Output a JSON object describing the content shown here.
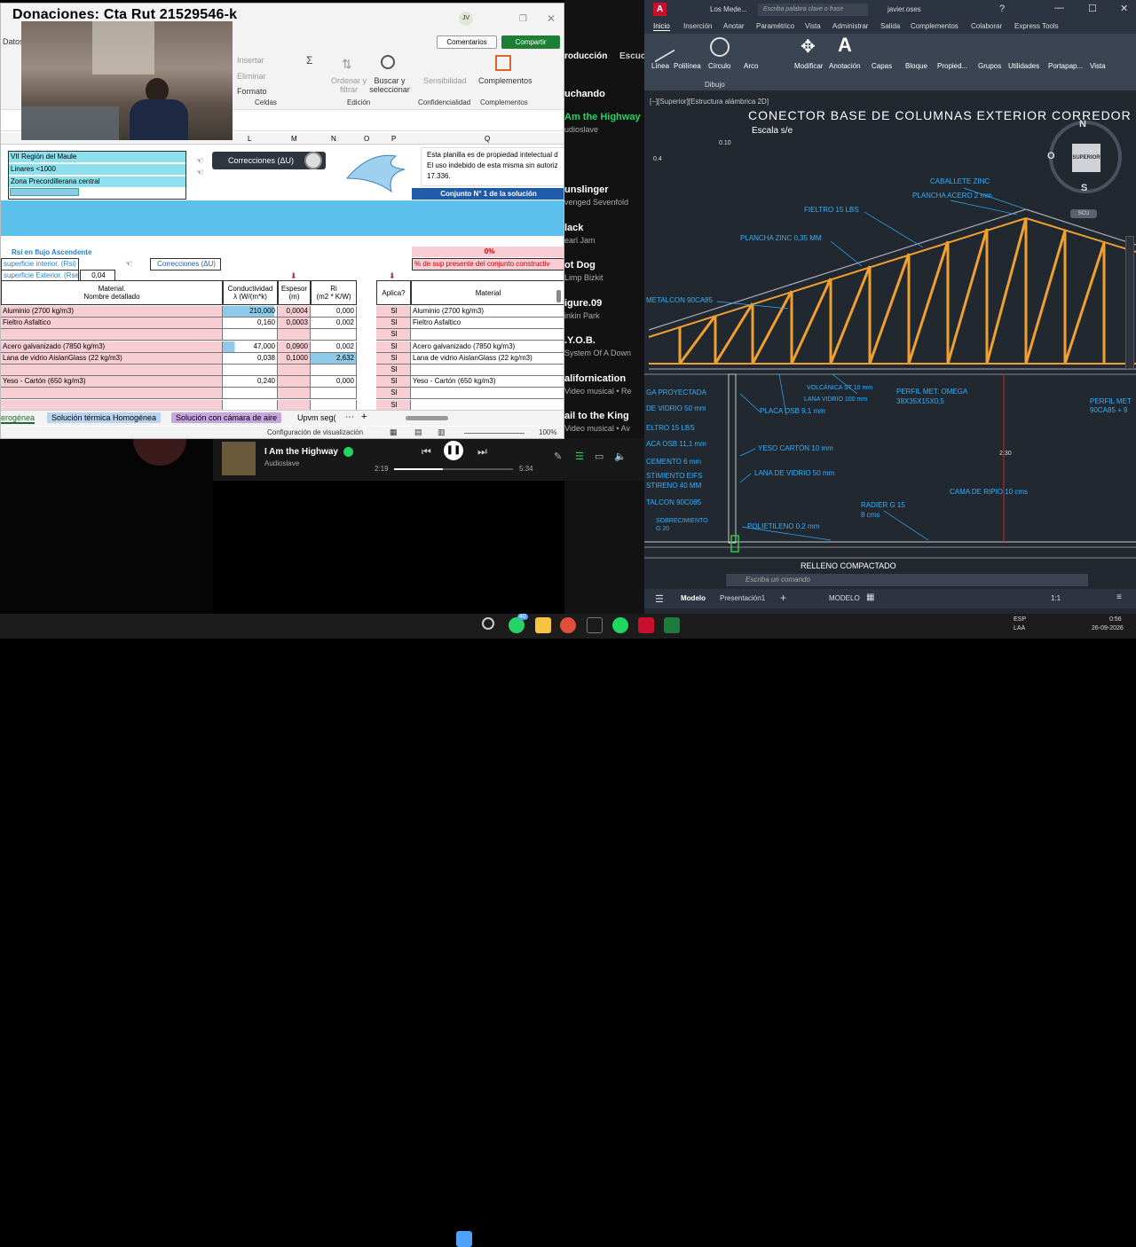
{
  "overlay_title": "Donaciones: Cta Rut 21529546-k",
  "excel": {
    "datos_tab": "Datos",
    "avatar": "JV",
    "comentarios": "Comentarios",
    "compartir": "Compartir",
    "ribbon": {
      "insertar": "Insertar",
      "eliminar": "Eliminar",
      "formato": "Formato",
      "celdas": "Celdas",
      "ordenar": "Ordenar y filtrar",
      "buscar": "Buscar y seleccionar",
      "edicion": "Edición",
      "sensibilidad": "Sensibilidad",
      "confidencialidad": "Confidencialidad",
      "complementos_btn": "Complementos",
      "complementos_grp": "Complementos"
    },
    "col_headers": [
      "L",
      "M",
      "N",
      "O",
      "P",
      "Q"
    ],
    "info_rows": [
      "VII Región del Maule",
      "Linares <1000",
      "Zona Precordillerana central"
    ],
    "correcciones_top": "Correcciones (ΔU)",
    "notice_1": "Esta planilla es de propiedad intelectual de I",
    "notice_2": "El uso indebido de esta misma sin autorizaci",
    "notice_3": "17.336.",
    "conjunto": "Conjunto N° 1 de la solución",
    "rsi_label": "Rsi en flujo Ascendente",
    "sup_int": "superficie interior. (Rsi)",
    "sup_ext": "superficie Exterior. (Rse)",
    "rse_val": "0,04",
    "correcciones_mid": "Correcciones (ΔU)",
    "pct": "0%",
    "pct_label": "% de sup presente del conjunto constructiv",
    "hdr_material": "Material.",
    "hdr_material2": "Nombre detallado",
    "hdr_cond": "Conductividad",
    "hdr_cond2": "λ (W/(m*k)",
    "hdr_esp": "Espesor",
    "hdr_esp2": "(m)",
    "hdr_ri": "Ri",
    "hdr_ri2": "(m2 * K/W)",
    "hdr_aplica": "Aplica?",
    "hdr_material_r": "Material",
    "rows": [
      {
        "mat": "Aluminio (2700 kg/m3)",
        "cond": "210,000",
        "esp": "0,0004",
        "ri": "0,000",
        "ap": "SI",
        "mat_r": "Aluminio (2700 kg/m3)"
      },
      {
        "mat": "Fieltro Asfaltico",
        "cond": "0,160",
        "esp": "0,0003",
        "ri": "0,002",
        "ap": "SI",
        "mat_r": "Fieltro Asfaltico"
      },
      {
        "mat": "",
        "cond": "",
        "esp": "",
        "ri": "",
        "ap": "SI",
        "mat_r": ""
      },
      {
        "mat": "Acero galvanizado (7850 kg/m3)",
        "cond": "47,000",
        "esp": "0,0900",
        "ri": "0,002",
        "ap": "SI",
        "mat_r": "Acero galvanizado (7850 kg/m3)"
      },
      {
        "mat": "Lana de vidrio AislanGlass (22 kg/m3)",
        "cond": "0,038",
        "esp": "0,1000",
        "ri": "2,632",
        "ap": "SI",
        "mat_r": "Lana de vidrio AislanGlass (22 kg/m3)"
      },
      {
        "mat": "",
        "cond": "",
        "esp": "",
        "ri": "",
        "ap": "SI",
        "mat_r": ""
      },
      {
        "mat": "Yeso - Cartón (650 kg/m3)",
        "cond": "0,240",
        "esp": "",
        "ri": "0,000",
        "ap": "SI",
        "mat_r": "Yeso - Cartón (650 kg/m3)"
      },
      {
        "mat": "",
        "cond": "",
        "esp": "",
        "ri": "",
        "ap": "SI",
        "mat_r": ""
      },
      {
        "mat": "",
        "cond": "",
        "esp": "",
        "ri": "",
        "ap": "SI",
        "mat_r": ""
      }
    ],
    "sheet_tabs": [
      "erogénea",
      "Solución térmica Homogénea",
      "Solución con cámara de aire",
      "Upvm seg("
    ],
    "status_config": "Configuración de visualización",
    "zoom": "100%"
  },
  "spotify": {
    "section": "roducción",
    "section2": "Escuc",
    "items": [
      {
        "title": "uchando",
        "artist": ""
      },
      {
        "title": "Am the Highway",
        "artist": "udioslave"
      },
      {
        "title": "unslinger",
        "artist": "venged Sevenfold"
      },
      {
        "title": "lack",
        "artist": "earl Jam"
      },
      {
        "title": "ot Dog",
        "artist": "Limp Bizkit"
      },
      {
        "title": "igure.09",
        "artist": "inkin Park"
      },
      {
        "title": ".Y.O.B.",
        "artist": "System Of A Down"
      },
      {
        "title": "alifornication",
        "artist": "Video musical • Re"
      },
      {
        "title": "ail to the King",
        "artist": "Video musical • Av"
      }
    ],
    "now_title": "I Am the Highway",
    "now_artist": "Audioslave",
    "time_cur": "2:19",
    "time_total": "5:34",
    "progress": 0.41
  },
  "acad": {
    "app": "A",
    "doc": "Los Mede...",
    "search_ph": "Escriba palabra clave o frase",
    "user": "javier.oses",
    "tabs": [
      "Inicio",
      "Inserción",
      "Anotar",
      "Paramétrico",
      "Vista",
      "Administrar",
      "Salida",
      "Complementos",
      "Colaborar",
      "Express Tools"
    ],
    "tools": [
      "Línea",
      "Polilínea",
      "Círculo",
      "Arco",
      "Modificar",
      "Anotación",
      "Capas",
      "Bloque",
      "Propied...",
      "Grupos",
      "Utilidades",
      "Portapap...",
      "Vista"
    ],
    "dibujo": "Dibujo",
    "viewport_label": "[−][Superior][Estructura alámbrica 2D]",
    "drawing_title": "CONECTOR BASE DE COLUMNAS EXTERIOR CORREDOR Y A",
    "escala": "Escala s/e",
    "viewcube": {
      "n": "N",
      "s": "S",
      "o": "O",
      "face": "SUPERIOR",
      "scu": "SCU"
    },
    "dims": [
      "0.10",
      "0.4",
      "2.30"
    ],
    "labels": [
      "CABALLETE ZINC",
      "PLANCHA ACERO 2 mm",
      "FIELTRO 15 LBS",
      "PLANCHA ZINC 0,35 MM",
      "METALCON 90CA85",
      "VOLCÁNICA ST 10 mm",
      "LANA VIDRIO 100 mm",
      "PERFIL MET. OMEGA",
      "38X35X15X0,5",
      "PERFIL MET",
      "90CA85 + 9",
      "GA PROYECTADA",
      "DE VIDRIO 50 mm",
      "PLACA OSB 9,1 mm",
      "ELTRO 15 LBS",
      "YESO CARTÓN 10 mm",
      "ACA OSB 11,1 mm",
      "CEMENTO 6 mm",
      "LANA DE VIDRIO 50 mm",
      "STIMIENTO EIFS",
      "STIRENO 40 MM",
      "TALCON 90C085",
      "RADIER G 15",
      "8 cms",
      "CAMA DE RIPIO 10 cms",
      "SOBRECIMIENTO",
      "G 20",
      "POLIETILENO 0,2 mm",
      "RELLENO COMPACTADO"
    ],
    "cmd_ph": "Escriba un comando",
    "layout_tabs": [
      "Modelo",
      "Presentación1"
    ],
    "modelo_btn": "MODELO",
    "scale": "1:1"
  },
  "taskbar": {
    "lang1": "ESP",
    "lang2": "LAA",
    "time": "0:56",
    "date": "26-09-2026",
    "badge": "40"
  }
}
